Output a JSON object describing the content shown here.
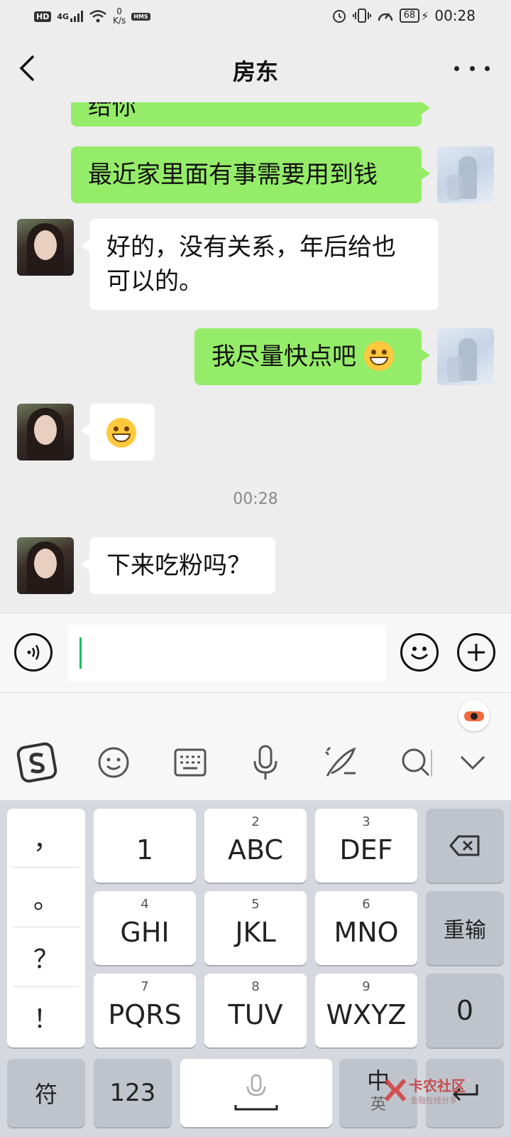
{
  "status_bar": {
    "hd": "HD",
    "net_type": "4G",
    "speed_value": "0",
    "speed_unit": "K/s",
    "hms": "HMS",
    "battery": "68",
    "time": "00:28"
  },
  "nav": {
    "title": "房东"
  },
  "chat": {
    "messages": [
      {
        "from": "me",
        "text": "给你"
      },
      {
        "from": "me",
        "text": "最近家里面有事需要用到钱"
      },
      {
        "from": "them",
        "text_line1": "好的，没有关系，年后给也",
        "text_line2": "可以的。"
      },
      {
        "from": "me",
        "text": "我尽量快点吧",
        "emoji": "crying-laughing-emoji"
      },
      {
        "from": "them",
        "emoji": "grinning-emoji"
      },
      {
        "from": "them",
        "text": "下来吃粉吗？"
      }
    ],
    "timestamp": "00:28"
  },
  "keyboard": {
    "punctuation": [
      "，",
      "。",
      "？",
      "！"
    ],
    "keys": [
      {
        "num": "",
        "label": "1"
      },
      {
        "num": "2",
        "label": "ABC"
      },
      {
        "num": "3",
        "label": "DEF"
      },
      {
        "num": "4",
        "label": "GHI"
      },
      {
        "num": "5",
        "label": "JKL"
      },
      {
        "num": "6",
        "label": "MNO"
      },
      {
        "num": "7",
        "label": "PQRS"
      },
      {
        "num": "8",
        "label": "TUV"
      },
      {
        "num": "9",
        "label": "WXYZ"
      }
    ],
    "reinput": "重输",
    "zero": "0",
    "symbol": "符",
    "num123": "123",
    "zh": "中",
    "en": "英"
  },
  "watermark": {
    "title": "卡农社区",
    "subtitle": "金融在线分享"
  },
  "colors": {
    "my_bubble": "#95ec69",
    "their_bubble": "#ffffff",
    "background": "#ededed",
    "caret": "#07c160"
  }
}
